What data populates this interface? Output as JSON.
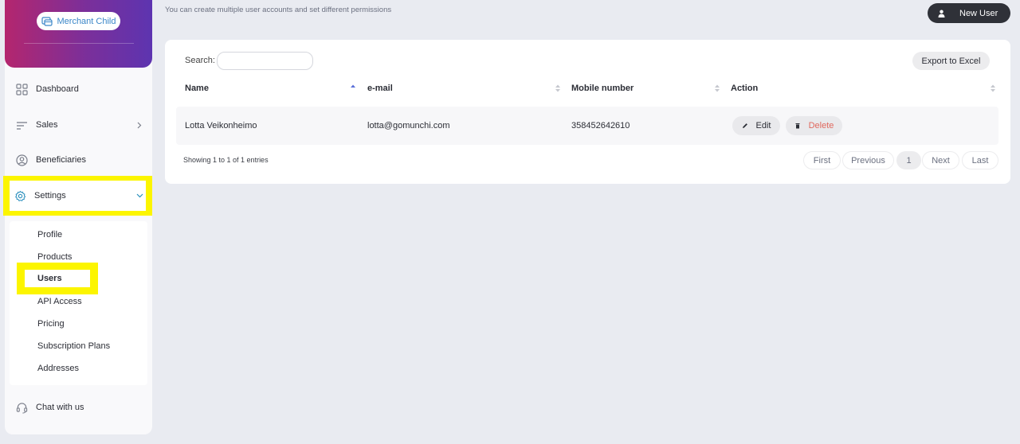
{
  "sidebar": {
    "merchant_label": "Merchant Child",
    "items": {
      "dashboard": "Dashboard",
      "sales": "Sales",
      "beneficiaries": "Beneficiaries",
      "settings": "Settings",
      "chat": "Chat with us"
    },
    "settings_submenu": {
      "profile": "Profile",
      "products": "Products",
      "users": "Users",
      "api_access": "API Access",
      "pricing": "Pricing",
      "subscription_plans": "Subscription Plans",
      "addresses": "Addresses"
    }
  },
  "header": {
    "subtitle": "You can create multiple user accounts and set different permissions",
    "new_user_label": "New User"
  },
  "table": {
    "search_label": "Search:",
    "search_value": "",
    "export_label": "Export to Excel",
    "columns": {
      "name": "Name",
      "email": "e-mail",
      "mobile": "Mobile number",
      "action": "Action"
    },
    "rows": [
      {
        "name": "Lotta Veikonheimo",
        "email": "lotta@gomunchi.com",
        "mobile": "358452642610",
        "edit_label": "Edit",
        "delete_label": "Delete"
      }
    ],
    "summary": "Showing 1 to 1 of 1 entries",
    "pagination": {
      "first": "First",
      "previous": "Previous",
      "current": "1",
      "next": "Next",
      "last": "Last"
    }
  },
  "colors": {
    "highlight": "#fcf500",
    "brand_gradient_start": "#b4266e",
    "brand_gradient_end": "#5d34b0",
    "delete": "#e0685e",
    "link": "#3a86c8",
    "gear_icon": "#2a8fbd"
  },
  "icons": {
    "merchant": "merchant-card-icon",
    "dashboard": "grid-icon",
    "sales": "list-icon",
    "beneficiaries": "user-circle-icon",
    "settings": "gear-icon",
    "chat": "headset-icon",
    "new_user": "user-icon",
    "edit": "pencil-icon",
    "delete": "trash-icon"
  }
}
